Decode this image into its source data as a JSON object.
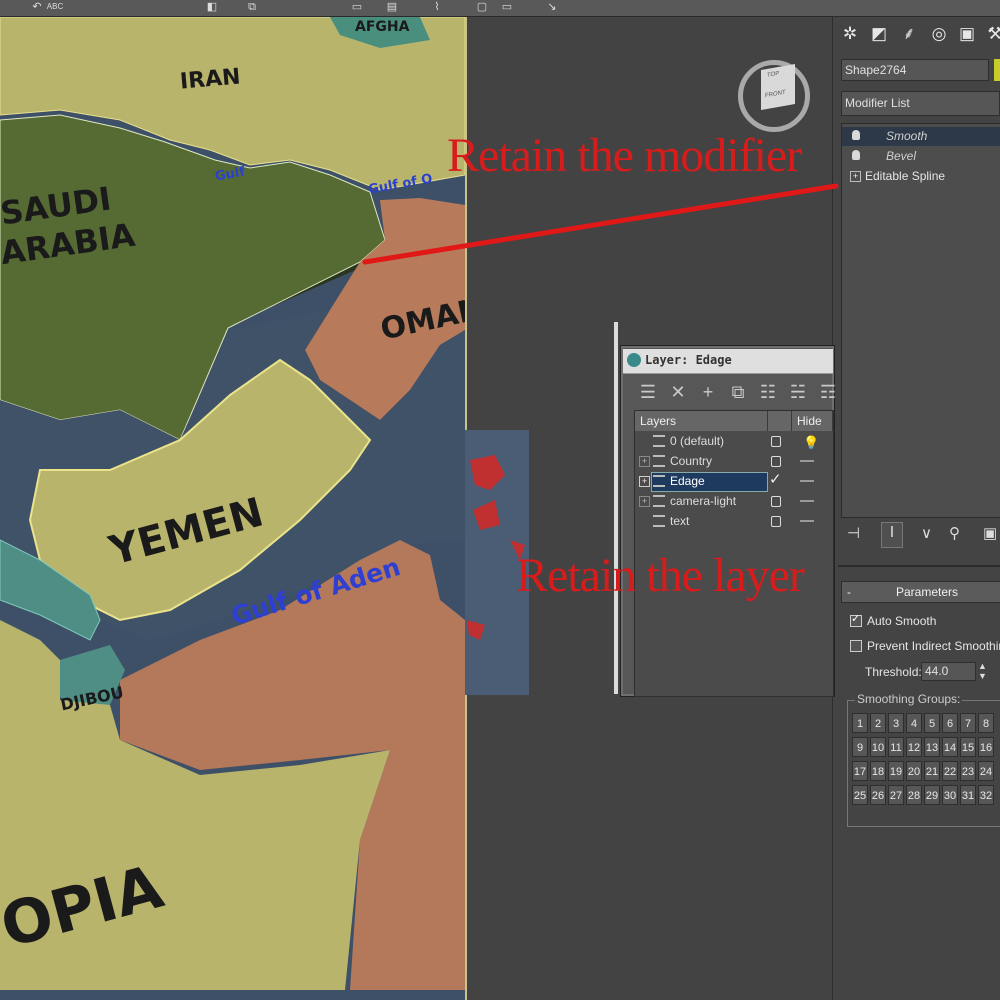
{
  "toolbar": {
    "abc_label": "ABC"
  },
  "viewport": {
    "map_labels": {
      "iran": "IRAN",
      "saudi_line1": "SAUDI",
      "saudi_line2": "ARABIA",
      "oman": "OMAN",
      "yemen": "YEMEN",
      "gulf_aden": "Gulf of Aden",
      "gulf1": "Gulf",
      "gulf2": "Gulf of O",
      "djibouti": "DJIBOU",
      "ethiopia": "OPIA",
      "afgh": "AFGHA"
    },
    "viewcube": {
      "top": "TOP",
      "front": "FRONT"
    }
  },
  "annotations": {
    "modifier": "Retain the modifier",
    "layer": "Retain the layer",
    "color": "#d81c1c"
  },
  "command_panel": {
    "object_name": "Shape2764",
    "modifier_list_label": "Modifier List",
    "stack": [
      {
        "label": "Smooth",
        "selected": true
      },
      {
        "label": "Bevel",
        "selected": false
      },
      {
        "label": "Editable Spline",
        "selected": false
      }
    ],
    "parameters": {
      "title": "Parameters",
      "auto_smooth_label": "Auto Smooth",
      "auto_smooth_checked": true,
      "prevent_label": "Prevent Indirect Smoothing",
      "prevent_checked": false,
      "threshold_label": "Threshold:",
      "threshold_value": "44.0",
      "smoothing_groups_label": "Smoothing Groups:",
      "groups": [
        "1",
        "2",
        "3",
        "4",
        "5",
        "6",
        "7",
        "8",
        "9",
        "10",
        "11",
        "12",
        "13",
        "14",
        "15",
        "16",
        "17",
        "18",
        "19",
        "20",
        "21",
        "22",
        "23",
        "24",
        "25",
        "26",
        "27",
        "28",
        "29",
        "30",
        "31",
        "32"
      ]
    }
  },
  "layer_dialog": {
    "title": "Layer: Edage",
    "columns": {
      "layers": "Layers",
      "hide": "Hide"
    },
    "rows": [
      {
        "name": "0 (default)",
        "expand": false,
        "current": false
      },
      {
        "name": "Country",
        "expand": true,
        "current": false
      },
      {
        "name": "Edage",
        "expand": true,
        "current": true
      },
      {
        "name": "camera-light",
        "expand": true,
        "current": false
      },
      {
        "name": "text",
        "expand": false,
        "current": false
      }
    ]
  },
  "colors": {
    "selected_row": "#1f3a5f",
    "stack_selected": "#2d3848",
    "accent_yellow": "#c8cc2a"
  }
}
